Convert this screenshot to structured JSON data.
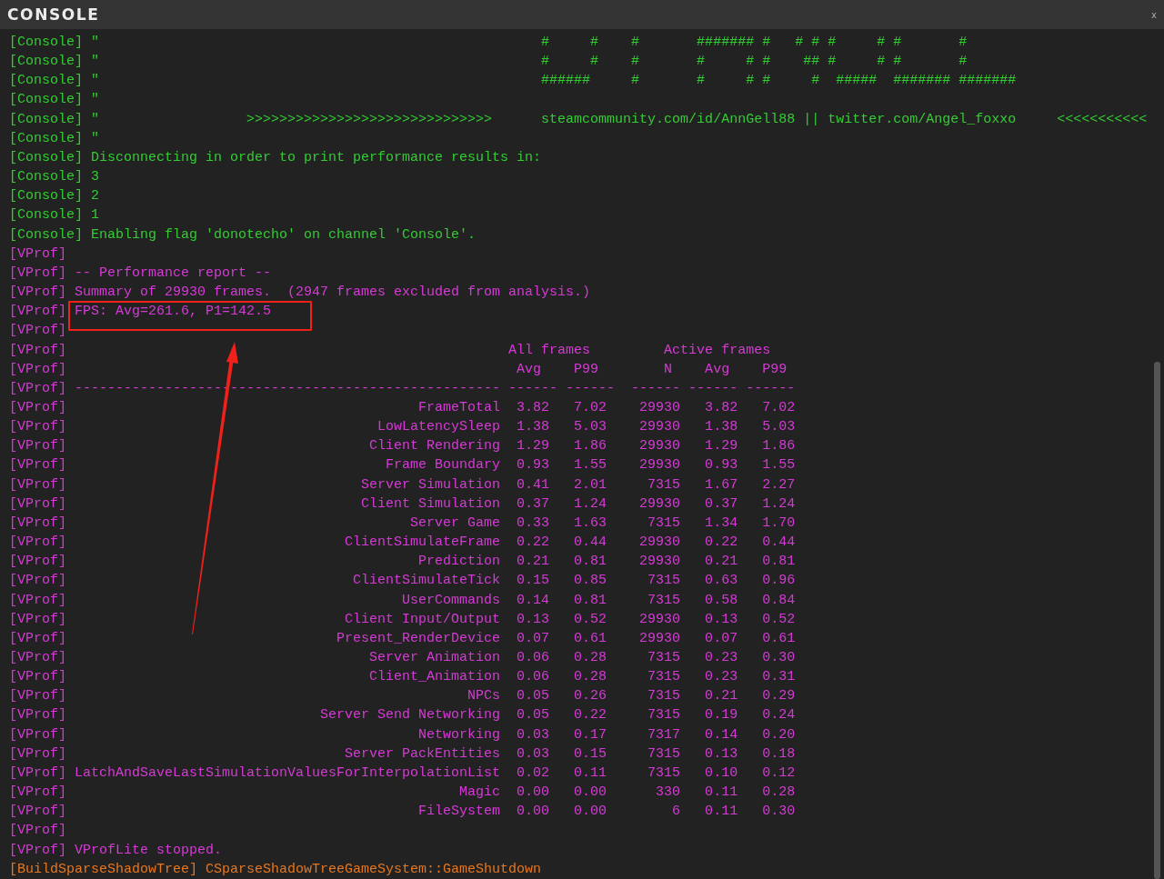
{
  "window": {
    "title": "CONSOLE",
    "close": "x"
  },
  "lines": [
    {
      "kind": "art",
      "prefix": "[Console]",
      "color": "#33cc33",
      "text": "\"",
      "art": "#     #    #       ####### #   # # #     # #       #"
    },
    {
      "kind": "art",
      "prefix": "[Console]",
      "color": "#33cc33",
      "text": "\"",
      "art": "#     #    #       #     # #    ## #     # #       #"
    },
    {
      "kind": "art",
      "prefix": "[Console]",
      "color": "#33cc33",
      "text": "\"",
      "art": "######     #       #     # #     #  #####  ####### #######"
    },
    {
      "kind": "text",
      "prefix": "[Console]",
      "color": "#33cc33",
      "text": "\""
    },
    {
      "kind": "banner",
      "prefix": "[Console]",
      "color": "#33cc33",
      "text": "\"",
      "arrows": ">>>>>>>>>>>>>>>>>>>>>>>>>>>>>>",
      "link": "steamcommunity.com/id/AnnGell88 || twitter.com/Angel_foxxo",
      "arrows_back": "<<<<<<<<<<<"
    },
    {
      "kind": "text",
      "prefix": "[Console]",
      "color": "#33cc33",
      "text": "\""
    },
    {
      "kind": "text",
      "prefix": "[Console]",
      "color": "#33cc33",
      "text": "Disconnecting in order to print performance results in:"
    },
    {
      "kind": "text",
      "prefix": "[Console]",
      "color": "#33cc33",
      "text": "3"
    },
    {
      "kind": "text",
      "prefix": "[Console]",
      "color": "#33cc33",
      "text": "2"
    },
    {
      "kind": "text",
      "prefix": "[Console]",
      "color": "#33cc33",
      "text": "1"
    },
    {
      "kind": "text",
      "prefix": "[Console]",
      "color": "#33cc33",
      "text": "Enabling flag 'donotecho' on channel 'Console'."
    },
    {
      "kind": "text",
      "prefix": "[VProf]",
      "color": "#d63ad6"
    },
    {
      "kind": "text",
      "prefix": "[VProf]",
      "color": "#d63ad6",
      "text": "-- Performance report --"
    },
    {
      "kind": "text",
      "prefix": "[VProf]",
      "color": "#d63ad6",
      "text": "Summary of 29930 frames.  (2947 frames excluded from analysis.)"
    },
    {
      "kind": "text",
      "prefix": "[VProf]",
      "color": "#d63ad6",
      "text": "FPS: Avg=261.6, P1=142.5",
      "highlighted": true
    },
    {
      "kind": "text",
      "prefix": "[VProf]",
      "color": "#d63ad6"
    },
    {
      "kind": "group_header",
      "prefix": "[VProf]",
      "color": "#d63ad6",
      "groups": [
        "All frames",
        "Active frames"
      ]
    },
    {
      "kind": "column_header",
      "prefix": "[VProf]",
      "color": "#d63ad6",
      "columns": [
        "Avg",
        "P99",
        "N",
        "Avg",
        "P99"
      ]
    },
    {
      "kind": "text",
      "prefix": "[VProf]",
      "color": "#d63ad6",
      "text": "---------------------------------------------------- ------ ------  ------ ------ ------"
    },
    {
      "kind": "row",
      "prefix": "[VProf]",
      "color": "#d63ad6",
      "cells": [
        "FrameTotal",
        "3.82",
        "7.02",
        "29930",
        "3.82",
        "7.02"
      ]
    },
    {
      "kind": "row",
      "prefix": "[VProf]",
      "color": "#d63ad6",
      "cells": [
        "LowLatencySleep",
        "1.38",
        "5.03",
        "29930",
        "1.38",
        "5.03"
      ]
    },
    {
      "kind": "row",
      "prefix": "[VProf]",
      "color": "#d63ad6",
      "cells": [
        "Client Rendering",
        "1.29",
        "1.86",
        "29930",
        "1.29",
        "1.86"
      ]
    },
    {
      "kind": "row",
      "prefix": "[VProf]",
      "color": "#d63ad6",
      "cells": [
        "Frame Boundary",
        "0.93",
        "1.55",
        "29930",
        "0.93",
        "1.55"
      ]
    },
    {
      "kind": "row",
      "prefix": "[VProf]",
      "color": "#d63ad6",
      "cells": [
        "Server Simulation",
        "0.41",
        "2.01",
        "7315",
        "1.67",
        "2.27"
      ]
    },
    {
      "kind": "row",
      "prefix": "[VProf]",
      "color": "#d63ad6",
      "cells": [
        "Client Simulation",
        "0.37",
        "1.24",
        "29930",
        "0.37",
        "1.24"
      ]
    },
    {
      "kind": "row",
      "prefix": "[VProf]",
      "color": "#d63ad6",
      "cells": [
        "Server Game",
        "0.33",
        "1.63",
        "7315",
        "1.34",
        "1.70"
      ]
    },
    {
      "kind": "row",
      "prefix": "[VProf]",
      "color": "#d63ad6",
      "cells": [
        "ClientSimulateFrame",
        "0.22",
        "0.44",
        "29930",
        "0.22",
        "0.44"
      ]
    },
    {
      "kind": "row",
      "prefix": "[VProf]",
      "color": "#d63ad6",
      "cells": [
        "Prediction",
        "0.21",
        "0.81",
        "29930",
        "0.21",
        "0.81"
      ]
    },
    {
      "kind": "row",
      "prefix": "[VProf]",
      "color": "#d63ad6",
      "cells": [
        "ClientSimulateTick",
        "0.15",
        "0.85",
        "7315",
        "0.63",
        "0.96"
      ]
    },
    {
      "kind": "row",
      "prefix": "[VProf]",
      "color": "#d63ad6",
      "cells": [
        "UserCommands",
        "0.14",
        "0.81",
        "7315",
        "0.58",
        "0.84"
      ]
    },
    {
      "kind": "row",
      "prefix": "[VProf]",
      "color": "#d63ad6",
      "cells": [
        "Client Input/Output",
        "0.13",
        "0.52",
        "29930",
        "0.13",
        "0.52"
      ]
    },
    {
      "kind": "row",
      "prefix": "[VProf]",
      "color": "#d63ad6",
      "cells": [
        "Present_RenderDevice",
        "0.07",
        "0.61",
        "29930",
        "0.07",
        "0.61"
      ]
    },
    {
      "kind": "row",
      "prefix": "[VProf]",
      "color": "#d63ad6",
      "cells": [
        "Server Animation",
        "0.06",
        "0.28",
        "7315",
        "0.23",
        "0.30"
      ]
    },
    {
      "kind": "row",
      "prefix": "[VProf]",
      "color": "#d63ad6",
      "cells": [
        "Client_Animation",
        "0.06",
        "0.28",
        "7315",
        "0.23",
        "0.31"
      ]
    },
    {
      "kind": "row",
      "prefix": "[VProf]",
      "color": "#d63ad6",
      "cells": [
        "NPCs",
        "0.05",
        "0.26",
        "7315",
        "0.21",
        "0.29"
      ]
    },
    {
      "kind": "row",
      "prefix": "[VProf]",
      "color": "#d63ad6",
      "cells": [
        "Server Send Networking",
        "0.05",
        "0.22",
        "7315",
        "0.19",
        "0.24"
      ]
    },
    {
      "kind": "row",
      "prefix": "[VProf]",
      "color": "#d63ad6",
      "cells": [
        "Networking",
        "0.03",
        "0.17",
        "7317",
        "0.14",
        "0.20"
      ]
    },
    {
      "kind": "row",
      "prefix": "[VProf]",
      "color": "#d63ad6",
      "cells": [
        "Server PackEntities",
        "0.03",
        "0.15",
        "7315",
        "0.13",
        "0.18"
      ]
    },
    {
      "kind": "row",
      "prefix": "[VProf]",
      "color": "#d63ad6",
      "cells": [
        "LatchAndSaveLastSimulationValuesForInterpolationList",
        "0.02",
        "0.11",
        "7315",
        "0.10",
        "0.12"
      ]
    },
    {
      "kind": "row",
      "prefix": "[VProf]",
      "color": "#d63ad6",
      "cells": [
        "Magic",
        "0.00",
        "0.00",
        "330",
        "0.11",
        "0.28"
      ]
    },
    {
      "kind": "row",
      "prefix": "[VProf]",
      "color": "#d63ad6",
      "cells": [
        "FileSystem",
        "0.00",
        "0.00",
        "6",
        "0.11",
        "0.30"
      ]
    },
    {
      "kind": "text",
      "prefix": "[VProf]",
      "color": "#d63ad6"
    },
    {
      "kind": "text",
      "prefix": "[VProf]",
      "color": "#d63ad6",
      "text": "VProfLite stopped."
    },
    {
      "kind": "text",
      "prefix": "[BuildSparseShadowTree]",
      "color": "#e8761d",
      "text": "CSparseShadowTreeGameSystem::GameShutdown"
    }
  ]
}
